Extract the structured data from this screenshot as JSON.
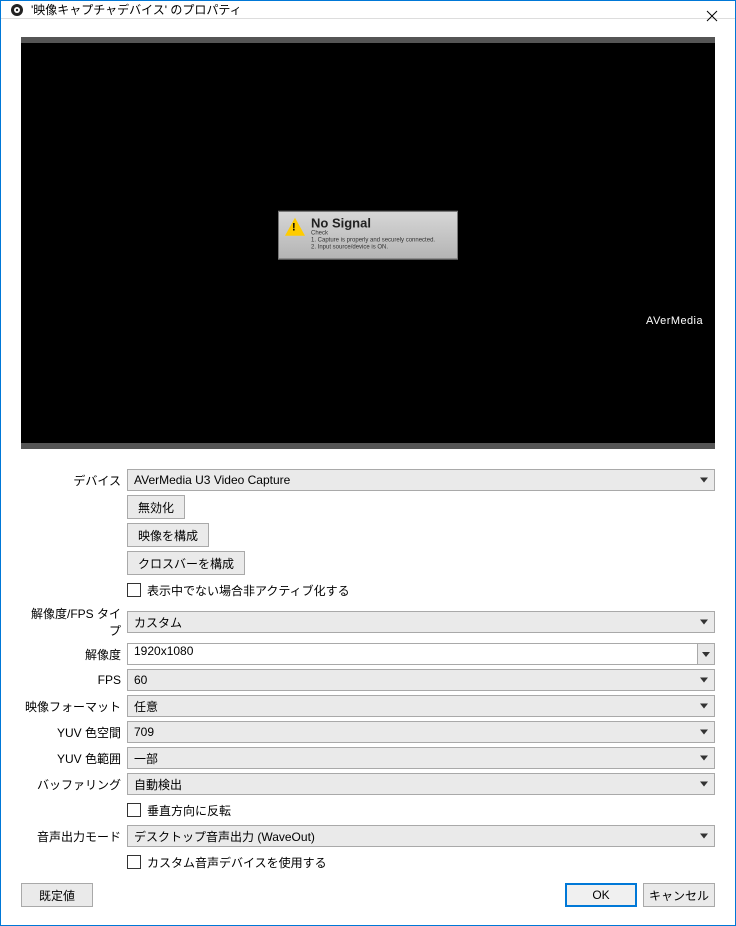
{
  "titlebar": {
    "title": "'映像キャプチャデバイス' のプロパティ"
  },
  "preview": {
    "nosignal_title": "No Signal",
    "nosignal_sub1": "Check",
    "nosignal_line1": "1. Capture is properly and securely connected.",
    "nosignal_line2": "2. Input source/device is ON.",
    "brand": "AVerMedia"
  },
  "labels": {
    "device": "デバイス",
    "res_fps_type": "解像度/FPS タイプ",
    "resolution": "解像度",
    "fps": "FPS",
    "video_format": "映像フォーマット",
    "yuv_space": "YUV 色空間",
    "yuv_range": "YUV 色範囲",
    "buffering": "バッファリング",
    "audio_output_mode": "音声出力モード"
  },
  "buttons": {
    "disable": "無効化",
    "configure_video": "映像を構成",
    "configure_crossbar": "クロスバーを構成",
    "defaults": "既定値",
    "ok": "OK",
    "cancel": "キャンセル"
  },
  "checkboxes": {
    "deactivate_not_showing": "表示中でない場合非アクティブ化する",
    "flip_vertical": "垂直方向に反転",
    "use_custom_audio_device": "カスタム音声デバイスを使用する"
  },
  "values": {
    "device": "AVerMedia U3 Video Capture",
    "res_fps_type": "カスタム",
    "resolution": "1920x1080",
    "fps": "60",
    "video_format": "任意",
    "yuv_space": "709",
    "yuv_range": "一部",
    "buffering": "自動検出",
    "audio_output_mode": "デスクトップ音声出力 (WaveOut)"
  }
}
